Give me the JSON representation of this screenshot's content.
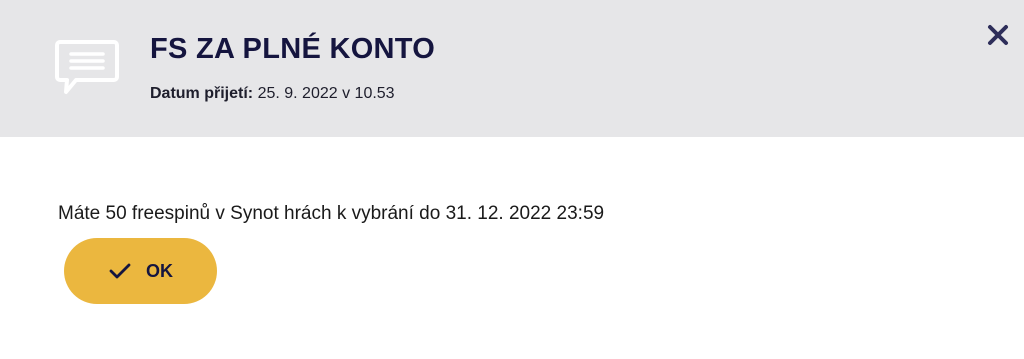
{
  "dialog": {
    "title": "FS ZA PLNÉ KONTO",
    "date_label": "Datum přijetí:",
    "date_value": "25. 9. 2022 v 10.53",
    "message": "Máte 50 freespinů v Synot hrách k vybrání do 31. 12. 2022 23:59",
    "ok_label": "OK",
    "icons": {
      "message": "speech-bubble-icon",
      "close": "close-icon",
      "confirm": "checkmark-icon"
    },
    "colors": {
      "header_bg": "#e6e6e8",
      "title": "#15153f",
      "button_bg": "#ebb73f"
    }
  }
}
